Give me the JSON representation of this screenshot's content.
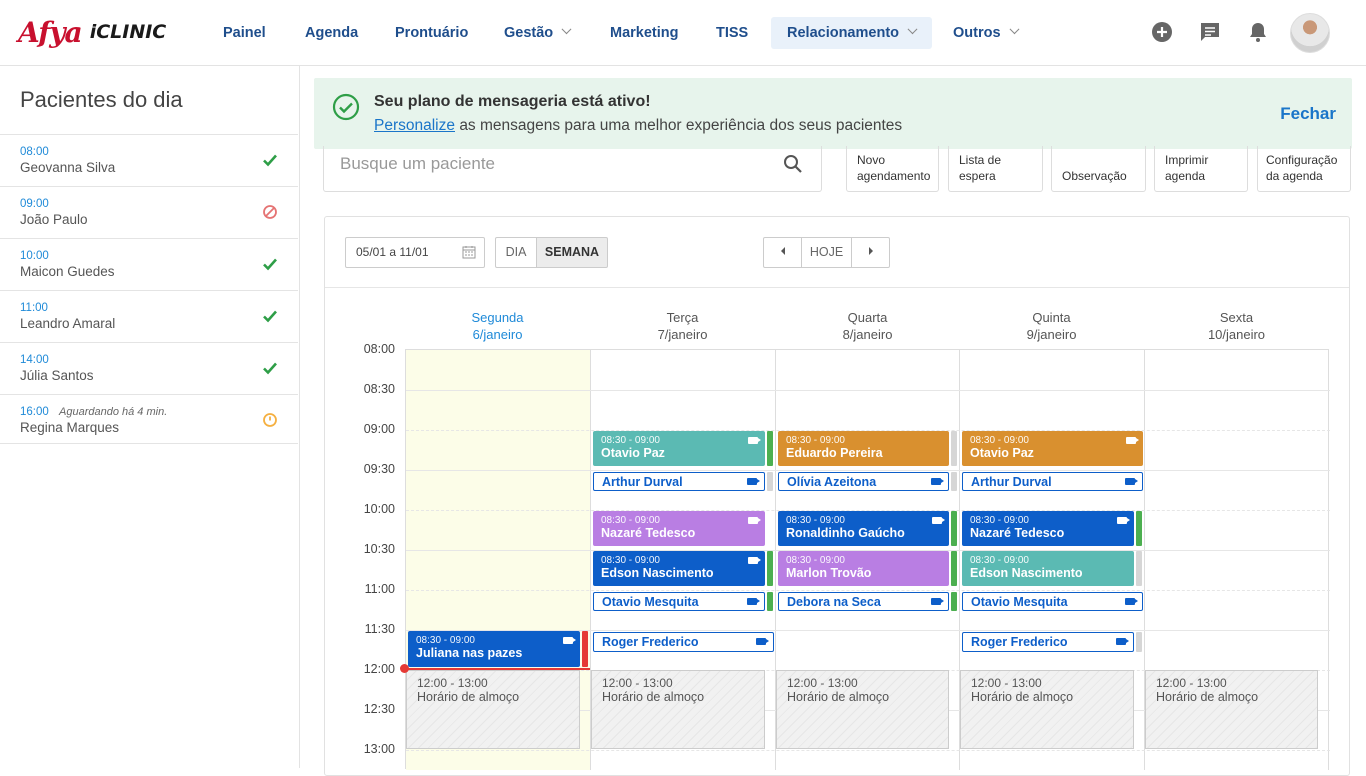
{
  "brand": {
    "afya": "Afya",
    "iclinic": "iCLINIC"
  },
  "nav": {
    "items": [
      {
        "label": "Painel"
      },
      {
        "label": "Agenda"
      },
      {
        "label": "Prontuário"
      },
      {
        "label": "Gestão"
      },
      {
        "label": "Marketing"
      },
      {
        "label": "TISS"
      },
      {
        "label": "Relacionamento"
      },
      {
        "label": "Outros"
      }
    ],
    "active": "Relacionamento",
    "icons": [
      "add-circle-icon",
      "chat-icon",
      "bell-icon"
    ]
  },
  "sidebar": {
    "title": "Pacientes do dia",
    "patients": [
      {
        "time": "08:00",
        "name": "Geovanna Silva",
        "wait": "",
        "status": "check"
      },
      {
        "time": "09:00",
        "name": "João Paulo",
        "wait": "",
        "status": "cancelled"
      },
      {
        "time": "10:00",
        "name": "Maicon Guedes",
        "wait": "",
        "status": "check"
      },
      {
        "time": "11:00",
        "name": "Leandro Amaral",
        "wait": "",
        "status": "check"
      },
      {
        "time": "14:00",
        "name": "Júlia Santos",
        "wait": "",
        "status": "check"
      },
      {
        "time": "16:00",
        "name": "Regina Marques",
        "wait": "Aguardando há 4 min.",
        "status": "waiting"
      }
    ]
  },
  "banner": {
    "title": "Seu plano de mensageria está ativo!",
    "link": "Personalize",
    "text": "as mensagens para uma melhor experiência dos seus pacientes",
    "close": "Fechar"
  },
  "search": {
    "placeholder": "Busque um paciente"
  },
  "actions": {
    "new": [
      "Novo",
      "agendamento"
    ],
    "waitlist": [
      "Lista de",
      "espera"
    ],
    "note": [
      "",
      "Observação"
    ],
    "print": [
      "Imprimir",
      "agenda"
    ],
    "config": [
      "Configuração",
      "da agenda"
    ]
  },
  "calendar": {
    "range": "05/01 a 11/01",
    "view_day": "DIA",
    "view_week": "SEMANA",
    "today": "HOJE",
    "days": [
      {
        "name": "Segunda",
        "date": "6/janeiro",
        "today": true
      },
      {
        "name": "Terça",
        "date": "7/janeiro"
      },
      {
        "name": "Quarta",
        "date": "8/janeiro"
      },
      {
        "name": "Quinta",
        "date": "9/janeiro"
      },
      {
        "name": "Sexta",
        "date": "10/janeiro"
      }
    ],
    "hours": [
      "08:00",
      "08:30",
      "09:00",
      "09:30",
      "10:00",
      "10:30",
      "11:00",
      "11:30",
      "12:00",
      "12:30",
      "13:00"
    ],
    "lunch": {
      "time": "12:00 - 13:00",
      "label": "Horário de almoço"
    },
    "colors": {
      "teal": "#5bbab3",
      "orange": "#d9902f",
      "purple": "#b97ee3",
      "blue": "#0d5ec9",
      "status_green": "#4caf50",
      "status_grey": "#d6d6d6",
      "status_red": "#e53935"
    },
    "events": {
      "mon": [
        {
          "time": "08:30 - 09:00",
          "name": "Juliana nas pazes"
        }
      ],
      "tue": [
        {
          "time": "08:30 - 09:00",
          "name": "Otavio Paz"
        },
        {
          "time": "",
          "name": "Arthur Durval"
        },
        {
          "time": "08:30 - 09:00",
          "name": "Nazaré Tedesco"
        },
        {
          "time": "08:30 - 09:00",
          "name": "Edson Nascimento"
        },
        {
          "time": "",
          "name": "Otavio Mesquita"
        },
        {
          "time": "",
          "name": "Roger Frederico"
        }
      ],
      "wed": [
        {
          "time": "08:30 - 09:00",
          "name": "Eduardo Pereira"
        },
        {
          "time": "",
          "name": "Olívia Azeitona"
        },
        {
          "time": "08:30 - 09:00",
          "name": "Ronaldinho Gaúcho"
        },
        {
          "time": "08:30 - 09:00",
          "name": "Marlon Trovão"
        },
        {
          "time": "",
          "name": "Debora na Seca"
        }
      ],
      "thu": [
        {
          "time": "08:30 - 09:00",
          "name": "Otavio Paz"
        },
        {
          "time": "",
          "name": "Arthur Durval"
        },
        {
          "time": "08:30 - 09:00",
          "name": "Nazaré Tedesco"
        },
        {
          "time": "08:30 - 09:00",
          "name": "Edson Nascimento"
        },
        {
          "time": "",
          "name": "Otavio Mesquita"
        },
        {
          "time": "",
          "name": "Roger Frederico"
        }
      ]
    }
  }
}
